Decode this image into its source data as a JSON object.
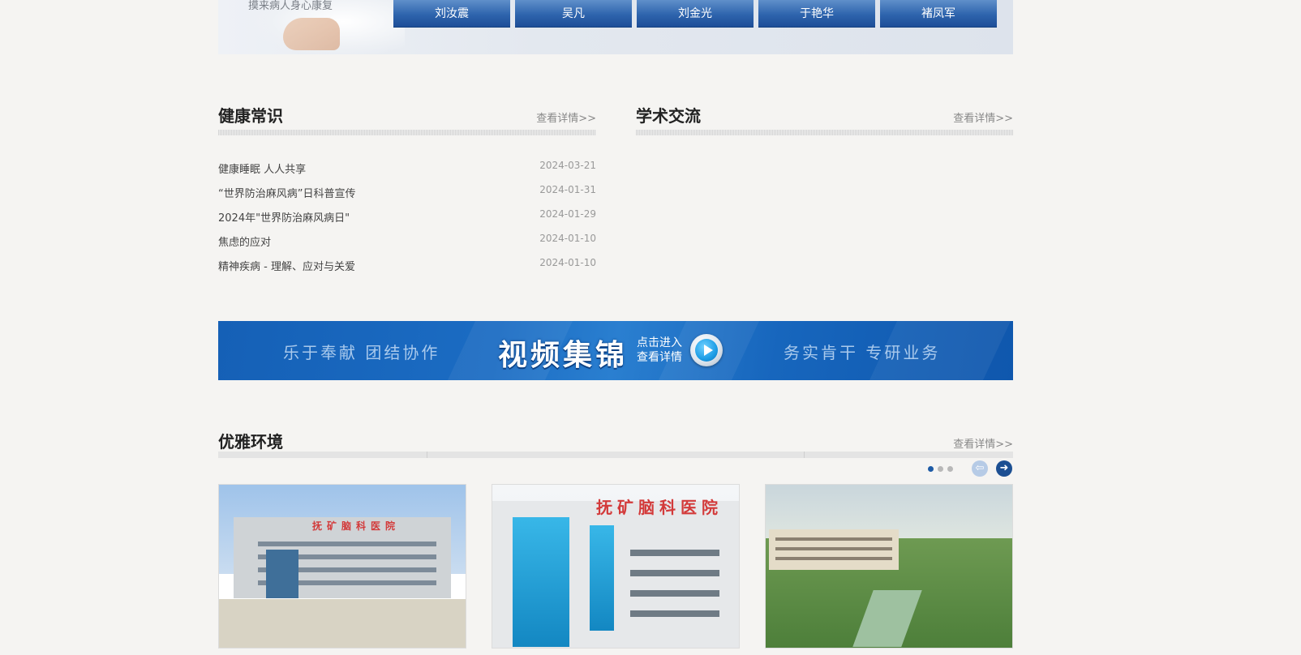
{
  "experts": {
    "slogan": "摸来病人身心康复",
    "doctors": [
      "刘汝震",
      "吴凡",
      "刘金光",
      "于艳华",
      "褚凤军"
    ]
  },
  "health": {
    "title": "健康常识",
    "more": "查看详情>>",
    "items": [
      {
        "title": "健康睡眠 人人共享",
        "date": "2024-03-21"
      },
      {
        "title": "“世界防治麻风病”日科普宣传",
        "date": "2024-01-31"
      },
      {
        "title": "2024年\"世界防治麻风病日\"",
        "date": "2024-01-29"
      },
      {
        "title": "焦虑的应对",
        "date": "2024-01-10"
      },
      {
        "title": "精神疾病 - 理解、应对与关爱",
        "date": "2024-01-10"
      }
    ]
  },
  "academic": {
    "title": "学术交流",
    "more": "查看详情>>"
  },
  "video": {
    "left_slogan": "乐于奉献  团结协作",
    "title": "视频集锦",
    "enter_line1": "点击进入",
    "enter_line2": "查看详情",
    "right_slogan": "务实肯干  专研业务",
    "play_icon": "play-circle-icon"
  },
  "environment": {
    "title": "优雅环境",
    "more": "查看详情>>",
    "photo_sign": "抚矿脑科医院",
    "prev_icon": "arrow-left-icon",
    "next_icon": "arrow-right-icon",
    "prev_glyph": "⇦",
    "next_glyph": "➜",
    "captions": [
      "",
      "",
      ""
    ]
  },
  "colors": {
    "accent_blue": "#1d5aa5",
    "background": "#f5f4f2"
  }
}
